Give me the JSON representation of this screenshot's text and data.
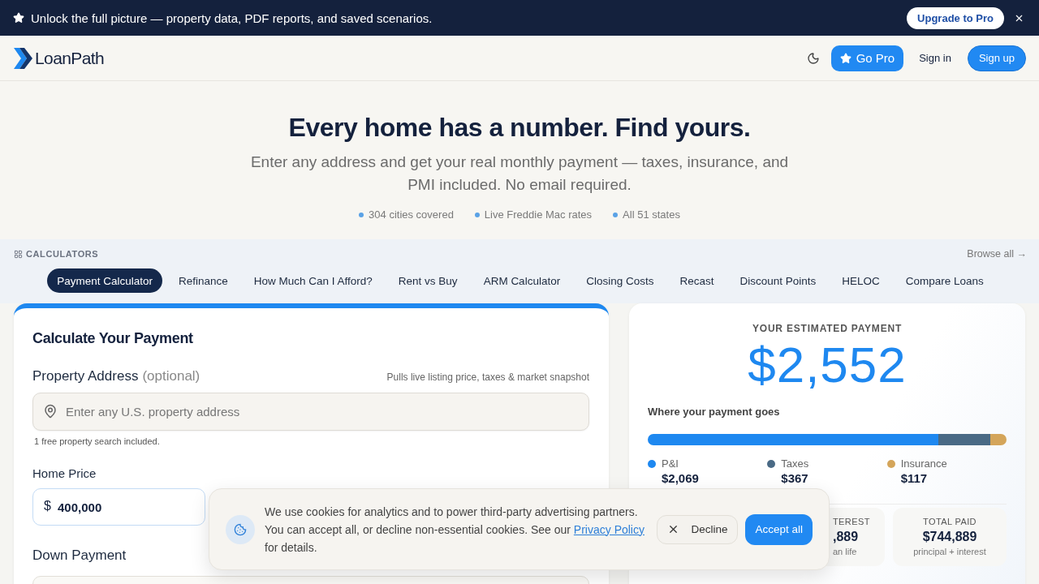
{
  "promo_bar": {
    "message": "Unlock the full picture — property data, PDF reports, and saved scenarios.",
    "button": "Upgrade to Pro"
  },
  "header": {
    "logo": "LoanPath",
    "buttons": [
      {
        "label": "Go Pro",
        "kind": "pro"
      },
      {
        "label": "Sign in",
        "kind": "link"
      },
      {
        "label": "Sign up",
        "kind": "primary"
      }
    ]
  },
  "hero": {
    "title": "Every home has a number. Find yours.",
    "subtitle": "Enter any address and get your real monthly payment — taxes, insurance, and PMI included. No email required.",
    "highlights": [
      "304 cities covered",
      "Live Freddie Mac rates",
      "All 51 states"
    ]
  },
  "calculators": {
    "label": "CALCULATORS",
    "browse": "Browse all →",
    "tabs": [
      {
        "label": "Payment Calculator",
        "selected": true
      },
      {
        "label": "Refinance",
        "selected": false
      },
      {
        "label": "How Much Can I Afford?",
        "selected": false
      },
      {
        "label": "Rent vs Buy",
        "selected": false
      },
      {
        "label": "ARM Calculator",
        "selected": false
      },
      {
        "label": "Closing Costs",
        "selected": false
      },
      {
        "label": "Recast",
        "selected": false
      },
      {
        "label": "Discount Points",
        "selected": false
      },
      {
        "label": "HELOC",
        "selected": false
      },
      {
        "label": "Compare Loans",
        "selected": false
      }
    ]
  },
  "form": {
    "title": "Calculate Your Payment",
    "address": {
      "label": "Property Address",
      "note": "(optional)",
      "hint": "Pulls live listing price, taxes & market snapshot",
      "placeholder": "Enter any U.S. property address",
      "help": "1 free property search included."
    },
    "fields": [
      {
        "label": "Home Price",
        "prefix": "$",
        "value": "400,000",
        "focused": true
      },
      {
        "label": "Down Payment",
        "focused": false
      }
    ]
  },
  "result": {
    "label": "YOUR ESTIMATED PAYMENT",
    "amount": "$2,552",
    "breakdown_title": "Where your payment goes",
    "breakdown": [
      {
        "name": "P&I",
        "amount": "$2,069",
        "color": "#1e88f0"
      },
      {
        "name": "Taxes",
        "amount": "$367",
        "color": "#4a6a85"
      },
      {
        "name": "Insurance",
        "amount": "$117",
        "color": "#d4a55a"
      }
    ],
    "stats": [
      {
        "kind": "clipped",
        "label": "TEREST",
        "value": ",889",
        "note": "an life"
      },
      {
        "kind": "full",
        "label": "TOTAL PAID",
        "value": "$744,889",
        "note": "principal + interest"
      }
    ]
  },
  "cookie_banner": {
    "text": "We use cookies for analytics and to power third-party advertising partners. You can accept all, or decline non-essential cookies. See our",
    "link": "Privacy Policy",
    "text_after": "for details.",
    "buttons": [
      {
        "label": "Decline",
        "kind": "secondary"
      },
      {
        "label": "Accept all",
        "kind": "primary"
      }
    ]
  }
}
